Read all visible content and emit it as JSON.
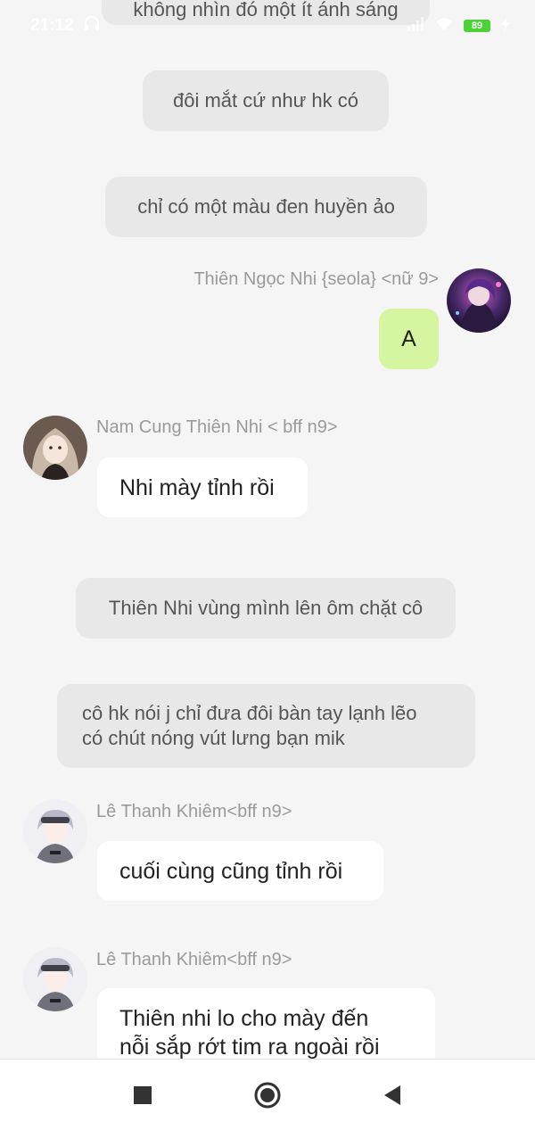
{
  "status_bar": {
    "time": "21:12",
    "battery": "89"
  },
  "messages": {
    "narr_top": "không nhìn đó một ít ánh sáng",
    "narr_1": "đôi mắt cứ như hk có",
    "narr_2": "chỉ có một màu đen huyền ảo",
    "out_sender": "Thiên Ngọc Nhi {seola} <nữ 9>",
    "out_text": "A",
    "in1_sender": "Nam Cung Thiên Nhi < bff n9>",
    "in1_text": "Nhi mày tỉnh rồi",
    "narr_3": "Thiên Nhi vùng mình lên ôm chặt cô",
    "narr_4_line1": "cô hk nói j chỉ đưa đôi bàn tay lạnh lẽo",
    "narr_4_line2": "có chút nóng vút lưng bạn mik",
    "in2_sender": "Lê Thanh Khiêm<bff n9>",
    "in2_text": "cuối cùng cũng tỉnh rồi",
    "in3_sender": "Lê Thanh Khiêm<bff n9>",
    "in3_line1": "Thiên nhi lo cho mày đến",
    "in3_line2": "nỗi sắp rớt tim ra ngoài rồi"
  },
  "icons": {
    "headphones": "headphones-icon",
    "signal": "signal-icon",
    "wifi": "wifi-icon",
    "charging": "charging-icon",
    "nav_recents": "square-icon",
    "nav_home": "circle-icon",
    "nav_back": "triangle-back-icon"
  },
  "colors": {
    "background": "#f5f5f5",
    "narration_bubble": "#e8e8e8",
    "incoming_bubble": "#ffffff",
    "outgoing_bubble": "#d6f5a0",
    "name_text": "#9a9a9a",
    "battery": "#4cd137"
  }
}
